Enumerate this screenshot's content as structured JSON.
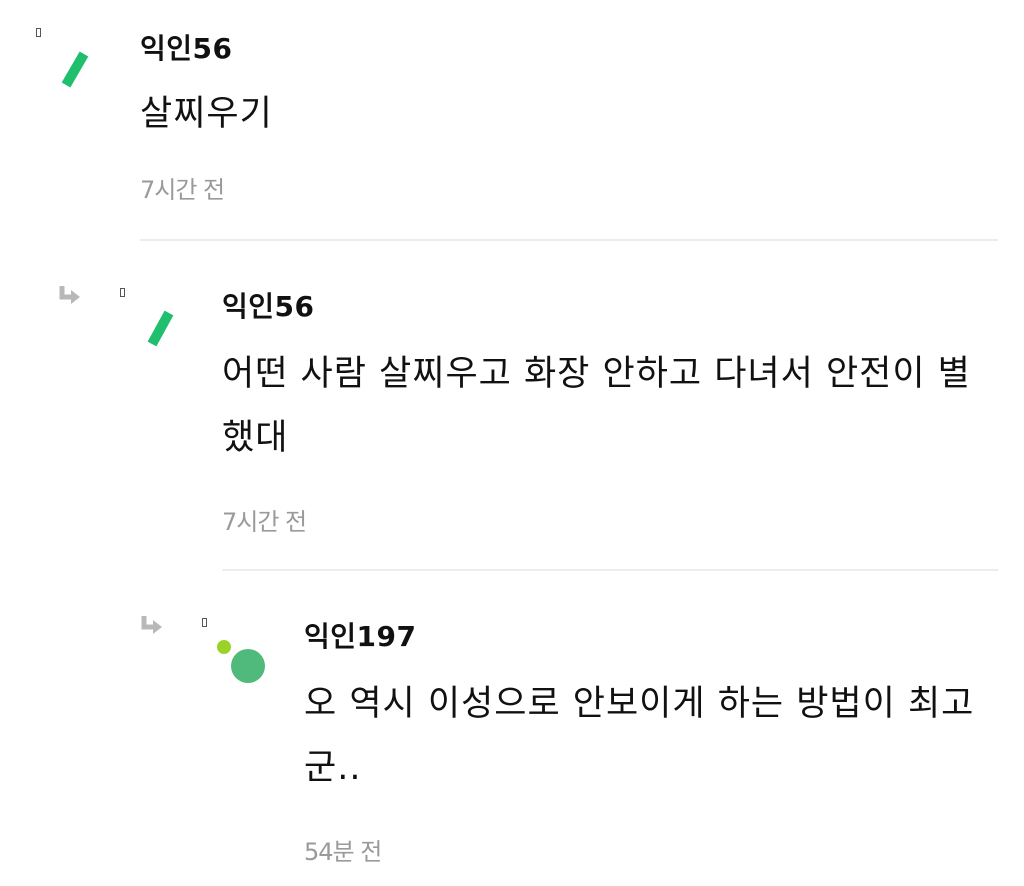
{
  "comments": [
    {
      "author": "익인56",
      "text": "살찌우기",
      "time": "7시간 전"
    },
    {
      "author": "익인56",
      "text": "어떤 사람 살찌우고 화장 안하고 다녀서 안전이 별했대",
      "time": "7시간 전"
    },
    {
      "author": "익인197",
      "text": "오 역시 이성으로 안보이게 하는 방법이 최고군..",
      "time": "54분 전"
    }
  ],
  "colors": {
    "avatar_stroke": "#1fbf6e",
    "avatar_dot_light": "#9ad22a",
    "avatar_dot_dark": "#4fba7c",
    "time_text": "#9a9a9a",
    "divider": "#ececec"
  },
  "icons": {
    "reply": "reply-arrow-icon",
    "marker": "small-box-icon"
  }
}
